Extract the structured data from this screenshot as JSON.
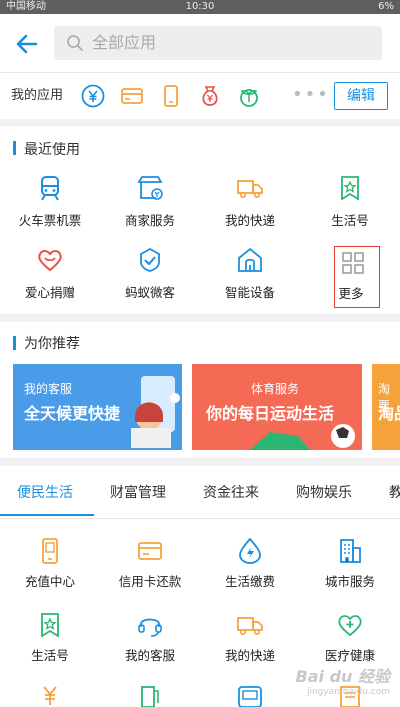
{
  "status": {
    "carrier": "中国移动",
    "time": "10:30",
    "battery": "6%"
  },
  "header": {
    "search_placeholder": "全部应用"
  },
  "my_apps": {
    "label": "我的应用",
    "icons": [
      "yuan-circle-icon",
      "card-icon",
      "phone-icon",
      "money-bag-icon",
      "sprout-icon"
    ],
    "more": "•••",
    "edit": "编辑"
  },
  "recent": {
    "title": "最近使用",
    "items": [
      {
        "label": "火车票机票",
        "icon": "train-icon"
      },
      {
        "label": "商家服务",
        "icon": "shop-icon"
      },
      {
        "label": "我的快递",
        "icon": "truck-icon"
      },
      {
        "label": "生活号",
        "icon": "star-bookmark-icon"
      },
      {
        "label": "爱心捐赠",
        "icon": "heart-icon"
      },
      {
        "label": "蚂蚁微客",
        "icon": "shield-check-icon"
      },
      {
        "label": "智能设备",
        "icon": "home-signal-icon"
      },
      {
        "label": "更多",
        "icon": "grid-icon"
      }
    ]
  },
  "recommend": {
    "title": "为你推荐",
    "banners": [
      {
        "small": "我的客服",
        "big": "全天候更快捷"
      },
      {
        "small": "体育服务",
        "big": "你的每日运动生活"
      },
      {
        "small": "淘票",
        "big": "淘品"
      }
    ]
  },
  "tabs": [
    "便民生活",
    "财富管理",
    "资金往来",
    "购物娱乐",
    "教"
  ],
  "services": {
    "items": [
      {
        "label": "充值中心",
        "icon": "phone-charge-icon"
      },
      {
        "label": "信用卡还款",
        "icon": "credit-card-icon"
      },
      {
        "label": "生活缴费",
        "icon": "lightning-icon"
      },
      {
        "label": "城市服务",
        "icon": "building-icon"
      },
      {
        "label": "生活号",
        "icon": "star-bookmark-icon"
      },
      {
        "label": "我的客服",
        "icon": "headset-icon"
      },
      {
        "label": "我的快递",
        "icon": "truck-icon"
      },
      {
        "label": "医疗健康",
        "icon": "medical-heart-icon"
      }
    ]
  },
  "watermark": {
    "brand": "Bai du 经验",
    "url": "jingyan.baidu.com"
  },
  "colors": {
    "accent": "#1a8fe0",
    "orange": "#f5a23c",
    "red": "#e9504a",
    "green": "#2bb673"
  }
}
